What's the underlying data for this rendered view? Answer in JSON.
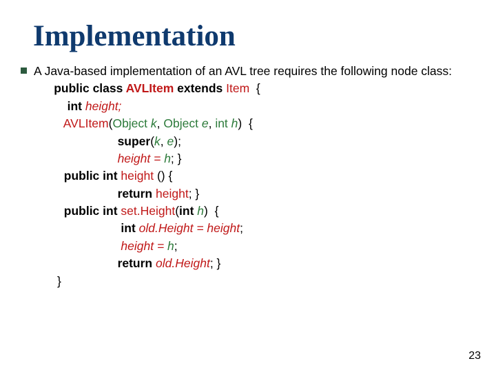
{
  "title": "Implementation",
  "intro": "A Java-based implementation of an AVL tree requires the following node class:",
  "code": {
    "l1": {
      "kw1": "public class ",
      "cls": "AVLItem",
      "kw2": " extends ",
      "sup": "Item",
      "tail": "  {"
    },
    "l2": {
      "kw": "int ",
      "name": "height;"
    },
    "l3": {
      "ctor": "AVLItem",
      "open": "(",
      "t1": "Object ",
      "p1": "k",
      "c1": ", ",
      "t2": "Object ",
      "p2": "e",
      "c2": ", ",
      "t3": "int ",
      "p3": "h",
      "close": ")",
      "tail": "  {"
    },
    "l4": {
      "kw": "super",
      "open": "(",
      "p1": "k",
      "c": ", ",
      "p2": "e",
      "close": ")",
      "tail": ";"
    },
    "l5": {
      "a": "height = ",
      "p": "h",
      "tail": "; }"
    },
    "l6": {
      "kw1": "public ",
      "kw2": "int ",
      "name": "height",
      "parens": " () ",
      "tail": "{"
    },
    "l7": {
      "kw": "return ",
      "name": "height",
      "tail": "; }"
    },
    "l8": {
      "kw1": "public ",
      "kw2": "int ",
      "name": "set.Height",
      "open": "(",
      "t": "int ",
      "p": "h",
      "close": ")",
      "tail": "  {"
    },
    "l9": {
      "kw": "int ",
      "name": "old.Height = height",
      "tail": ";"
    },
    "l10": {
      "a": "height = ",
      "p": "h",
      "tail": ";"
    },
    "l11": {
      "kw": "return ",
      "name": "old.Height",
      "tail": "; }"
    },
    "l12": "}"
  },
  "pagenum": "23"
}
